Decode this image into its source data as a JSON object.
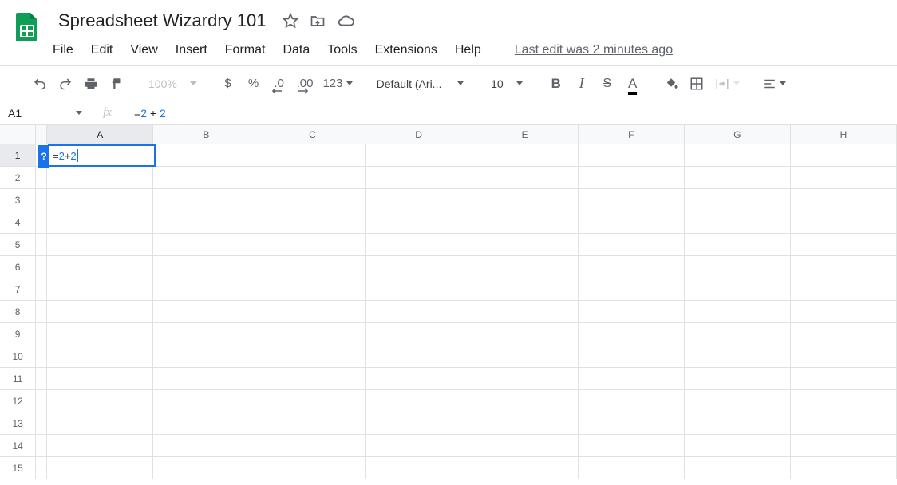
{
  "doc": {
    "title": "Spreadsheet Wizardry 101"
  },
  "menus": {
    "file": "File",
    "edit": "Edit",
    "view": "View",
    "insert": "Insert",
    "format": "Format",
    "data": "Data",
    "tools": "Tools",
    "extensions": "Extensions",
    "help": "Help",
    "last_edit": "Last edit was 2 minutes ago"
  },
  "toolbar": {
    "zoom": "100%",
    "currency": "$",
    "percent": "%",
    "dec_less": ".0",
    "dec_more": ".00",
    "more_formats": "123",
    "font": "Default (Ari...",
    "size": "10",
    "bold": "B",
    "italic": "I",
    "strike": "S",
    "text_color": "A"
  },
  "formula_bar": {
    "cell_ref": "A1",
    "prefix": "=",
    "tok1": "2",
    "op": " + ",
    "tok2": "2"
  },
  "grid": {
    "columns": [
      "A",
      "B",
      "C",
      "D",
      "E",
      "F",
      "G",
      "H"
    ],
    "rows": [
      "1",
      "2",
      "3",
      "4",
      "5",
      "6",
      "7",
      "8",
      "9",
      "10",
      "11",
      "12",
      "13",
      "14",
      "15"
    ],
    "active": {
      "col": "A",
      "row": "1"
    },
    "help_badge": "?"
  }
}
